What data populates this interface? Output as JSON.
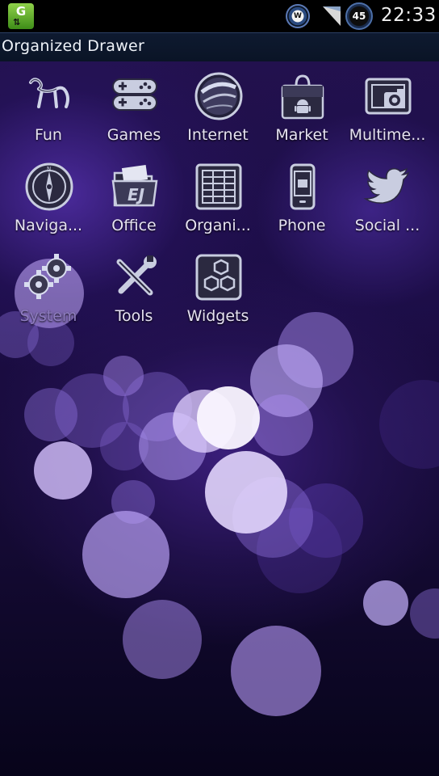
{
  "status_bar": {
    "app_badge_letter": "G",
    "weather_badge": "W",
    "battery_level": "45",
    "time": "22:33"
  },
  "header": {
    "title": "Organized Drawer"
  },
  "apps": [
    {
      "label": "Fun",
      "icon": "dog-balloon-icon"
    },
    {
      "label": "Games",
      "icon": "gamepad-icon"
    },
    {
      "label": "Internet",
      "icon": "globe-icon"
    },
    {
      "label": "Market",
      "icon": "market-bag-icon"
    },
    {
      "label": "Multime...",
      "icon": "photo-camera-icon"
    },
    {
      "label": "Naviga...",
      "icon": "compass-icon"
    },
    {
      "label": "Office",
      "icon": "folder-icon"
    },
    {
      "label": "Organi...",
      "icon": "grid-organizer-icon"
    },
    {
      "label": "Phone",
      "icon": "phone-icon"
    },
    {
      "label": "Social ...",
      "icon": "bird-icon"
    },
    {
      "label": "System",
      "icon": "gears-icon"
    },
    {
      "label": "Tools",
      "icon": "wrench-screwdriver-icon"
    },
    {
      "label": "Widgets",
      "icon": "hexagons-icon"
    }
  ],
  "colors": {
    "accent": "#4c6fa8",
    "wallpaper": "#241250",
    "bokeh": "#b9a3ff"
  }
}
